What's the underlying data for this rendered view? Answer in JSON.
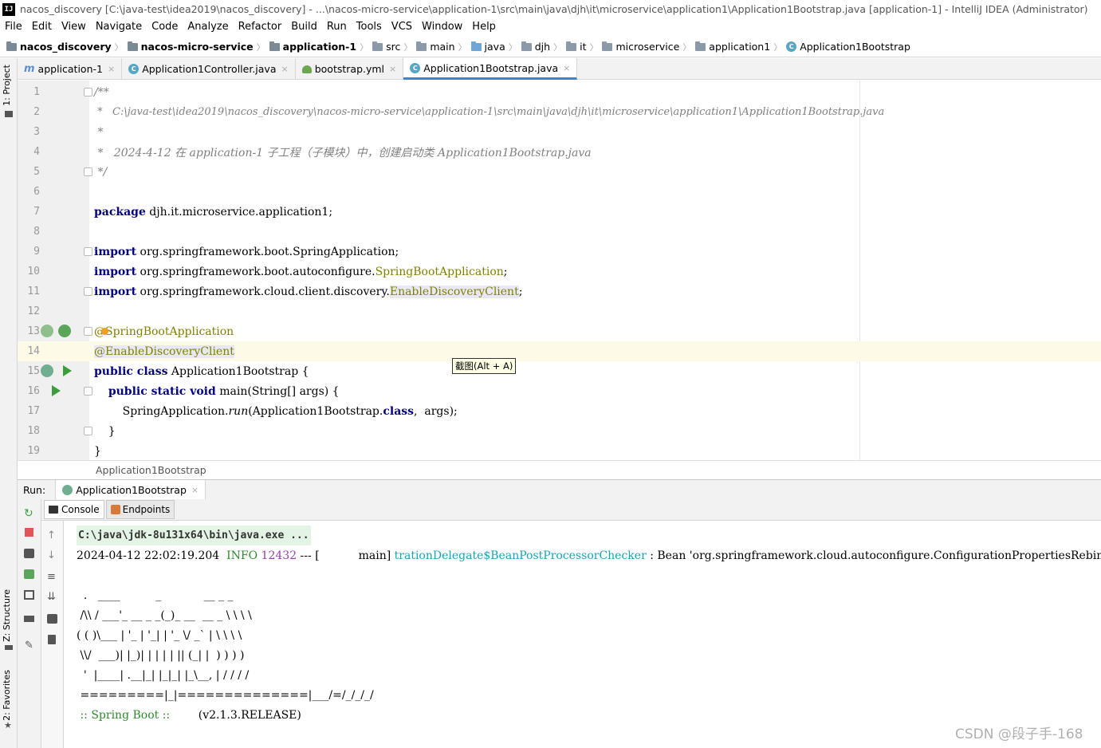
{
  "window": {
    "title": "nacos_discovery [C:\\java-test\\idea2019\\nacos_discovery] - ...\\nacos-micro-service\\application-1\\src\\main\\java\\djh\\it\\microservice\\application1\\Application1Bootstrap.java [application-1] - IntelliJ IDEA (Administrator)",
    "logo": "IJ"
  },
  "menu": [
    "File",
    "Edit",
    "View",
    "Navigate",
    "Code",
    "Analyze",
    "Refactor",
    "Build",
    "Run",
    "Tools",
    "VCS",
    "Window",
    "Help"
  ],
  "breadcrumbs": [
    {
      "label": "nacos_discovery",
      "bold": true,
      "icon": "module"
    },
    {
      "label": "nacos-micro-service",
      "bold": true,
      "icon": "module"
    },
    {
      "label": "application-1",
      "bold": true,
      "icon": "module"
    },
    {
      "label": "src",
      "bold": false,
      "icon": "folder"
    },
    {
      "label": "main",
      "bold": false,
      "icon": "folder"
    },
    {
      "label": "java",
      "bold": false,
      "icon": "blue"
    },
    {
      "label": "djh",
      "bold": false,
      "icon": "folder"
    },
    {
      "label": "it",
      "bold": false,
      "icon": "folder"
    },
    {
      "label": "microservice",
      "bold": false,
      "icon": "folder"
    },
    {
      "label": "application1",
      "bold": false,
      "icon": "folder"
    },
    {
      "label": "Application1Bootstrap",
      "bold": false,
      "icon": "class"
    }
  ],
  "sidebar": {
    "project": "1: Project",
    "structure": "Z: Structure",
    "favorites": "2: Favorites"
  },
  "tabs": [
    {
      "label": "application-1",
      "icon": "maven-icon",
      "active": false
    },
    {
      "label": "Application1Controller.java",
      "icon": "class-icon",
      "active": false
    },
    {
      "label": "bootstrap.yml",
      "icon": "yml-icon",
      "active": false
    },
    {
      "label": "Application1Bootstrap.java",
      "icon": "class-icon",
      "active": true
    }
  ],
  "tab_close": "×",
  "code": {
    "l1": "/**",
    "l2": " *   C:\\java-test\\idea2019\\nacos_discovery\\nacos-micro-service\\application-1\\src\\main\\java\\djh\\it\\microservice\\application1\\Application1Bootstrap.java",
    "l3": " *",
    "l4": " *   2024-4-12 在 application-1 子工程（子模块）中，创建启动类 Application1Bootstrap.java",
    "l5": " */",
    "l7_kw": "package",
    "l7_rest": " djh.it.microservice.application1;",
    "l9_kw": "import",
    "l9_rest": " org.springframework.boot.SpringApplication;",
    "l10_kw": "import",
    "l10_rest": " org.springframework.boot.autoconfigure.",
    "l10_ann": "SpringBootApplication",
    "l10_end": ";",
    "l11_kw": "import",
    "l11_rest": " org.springframework.cloud.client.discovery.",
    "l11_ann": "EnableDiscoveryClient",
    "l11_end": ";",
    "l13": "@SpringBootApplication",
    "l14": "@EnableDiscoveryClient",
    "l15_kw": "public class",
    "l15_rest": " Application1Bootstrap {",
    "l16_indent": "    ",
    "l16_kw": "public static void",
    "l16_rest": " main(String[] args) {",
    "l17_pre": "        SpringApplication.",
    "l17_run": "run",
    "l17_mid": "(Application1Bootstrap.",
    "l17_kw": "class",
    "l17_end": ",  args);",
    "l18": "    }",
    "l19": "}"
  },
  "line_numbers": [
    "1",
    "2",
    "3",
    "4",
    "5",
    "6",
    "7",
    "8",
    "9",
    "10",
    "11",
    "12",
    "13",
    "14",
    "15",
    "16",
    "17",
    "18",
    "19"
  ],
  "editor_breadcrumb": "Application1Bootstrap",
  "tooltip": "截图(Alt + A)",
  "run": {
    "label": "Run:",
    "tab": "Application1Bootstrap",
    "console_tab": "Console",
    "endpoints_tab": "Endpoints"
  },
  "console": {
    "cmd": "C:\\java\\jdk-8u131x64\\bin\\java.exe ...",
    "log_time": "2024-04-12 22:02:19.204  ",
    "log_level": "INFO",
    "log_pid": " 12432",
    "log_mid": " --- [           main] ",
    "log_class": "trationDelegate$BeanPostProcessorChecker",
    "log_msg": " : Bean 'org.springframework.cloud.autoconfigure.ConfigurationPropertiesRebinderAutoConfiguration'",
    "banner": [
      "  .   ____          _            __ _ _",
      " /\\\\ / ___'_ __ _ _(_)_ __  __ _ \\ \\ \\ \\",
      "( ( )\\___ | '_ | '_| | '_ \\/ _` | \\ \\ \\ \\",
      " \\\\/  ___)| |_)| | | | | || (_| |  ) ) ) )",
      "  '  |____| .__|_| |_|_| |_\\__, | / / / /",
      " =========|_|==============|___/=/_/_/_/"
    ],
    "spring_boot": " :: Spring Boot :: ",
    "version": "       (v2.1.3.RELEASE)"
  },
  "watermark": "CSDN @段子手-168",
  "colors": {
    "keyword": "#000080",
    "comment": "#808080",
    "annotation": "#808000",
    "current_line": "#fdfae8",
    "active_tab_underline": "#4083c9",
    "run_green": "#3b9e3b"
  }
}
